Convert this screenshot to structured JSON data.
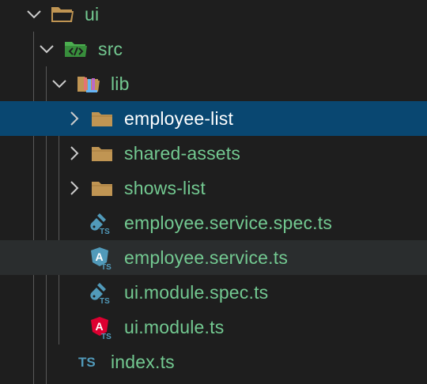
{
  "colors": {
    "background": "#1e1e1e",
    "selected_row": "#094771",
    "hover_row": "#2a2d2e",
    "label_green": "#73c991",
    "label_selected": "#ffffff",
    "folder": "#c09553",
    "ts_blue": "#519aba",
    "angular_red": "#dd0031"
  },
  "tree": {
    "ui": {
      "label": "ui",
      "icon": "folder-open-icon",
      "expanded": true
    },
    "src": {
      "label": "src",
      "icon": "folder-src-icon",
      "expanded": true
    },
    "lib": {
      "label": "lib",
      "icon": "folder-lib-icon",
      "expanded": true
    },
    "employee_list": {
      "label": "employee-list",
      "icon": "folder-icon",
      "expanded": false,
      "selected": true
    },
    "shared_assets": {
      "label": "shared-assets",
      "icon": "folder-icon",
      "expanded": false
    },
    "shows_list": {
      "label": "shows-list",
      "icon": "folder-icon",
      "expanded": false
    },
    "employee_service_spec": {
      "label": "employee.service.spec.ts",
      "icon": "test-ts-icon"
    },
    "employee_service": {
      "label": "employee.service.ts",
      "icon": "angular-service-icon"
    },
    "ui_module_spec": {
      "label": "ui.module.spec.ts",
      "icon": "test-ts-icon"
    },
    "ui_module": {
      "label": "ui.module.ts",
      "icon": "angular-module-icon"
    },
    "index": {
      "label": "index.ts",
      "icon": "typescript-icon",
      "icon_text": "TS"
    }
  },
  "icon_text": {
    "ts_small": "TS",
    "angular_a": "A"
  }
}
